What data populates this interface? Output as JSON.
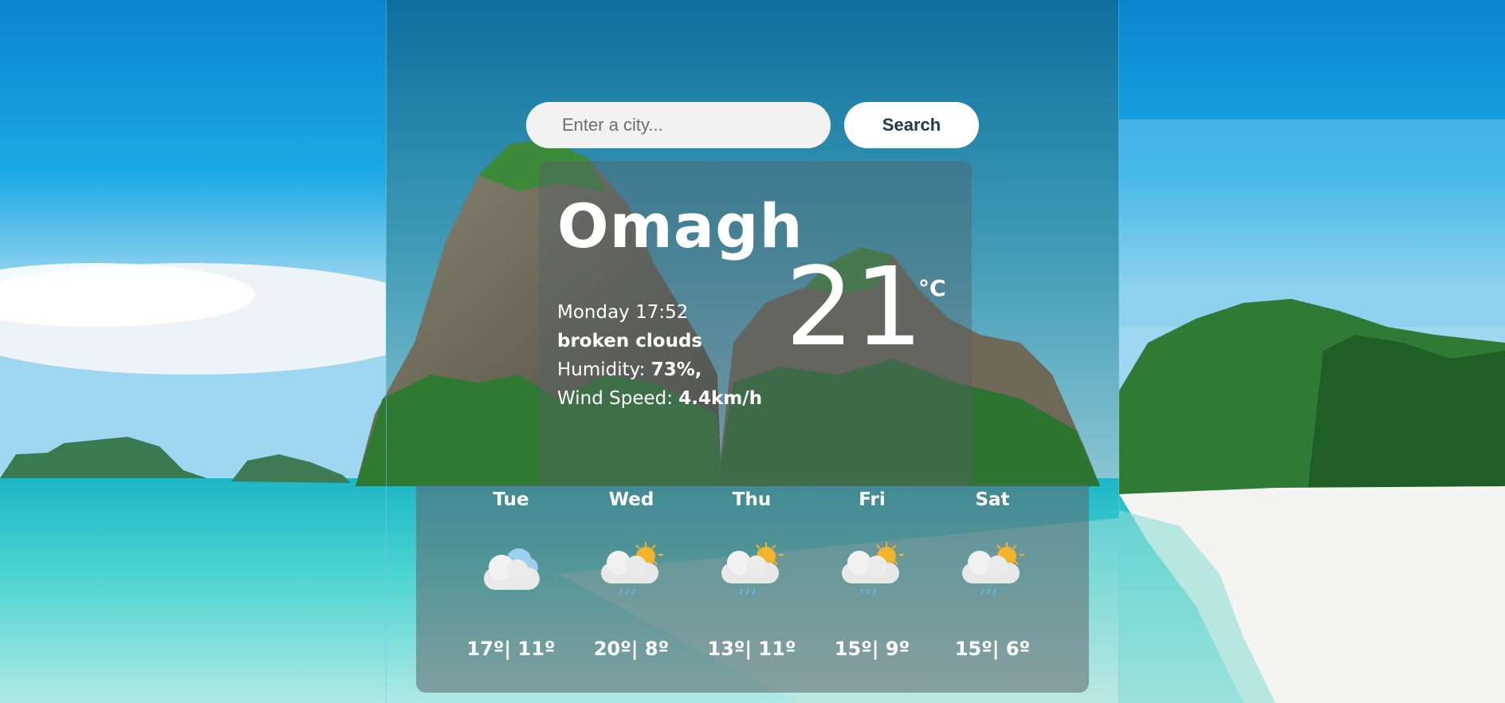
{
  "search": {
    "placeholder": "Enter a city...",
    "value": "",
    "button_label": "Search"
  },
  "current": {
    "city": "Omagh",
    "temperature": "21",
    "unit": "°C",
    "datetime": "Monday 17:52",
    "description": "broken clouds",
    "humidity_label": "Humidity: ",
    "humidity_value": "73%,",
    "wind_label": "Wind Speed: ",
    "wind_value": "4.4km/h"
  },
  "forecast": [
    {
      "day": "Tue",
      "temps": "17º| 11º",
      "icon": "cloudy-icon"
    },
    {
      "day": "Wed",
      "temps": "20º| 8º",
      "icon": "sun-cloud-rain-icon"
    },
    {
      "day": "Thu",
      "temps": "13º| 11º",
      "icon": "sun-cloud-rain-icon"
    },
    {
      "day": "Fri",
      "temps": "15º| 9º",
      "icon": "sun-cloud-rain-icon"
    },
    {
      "day": "Sat",
      "temps": "15º| 6º",
      "icon": "sun-cloud-rain-icon"
    }
  ],
  "colors": {
    "sky_top": "#0a8fd6",
    "sea": "#3ecfd0",
    "card": "#5f6469",
    "button_text": "#1f3a4a"
  }
}
